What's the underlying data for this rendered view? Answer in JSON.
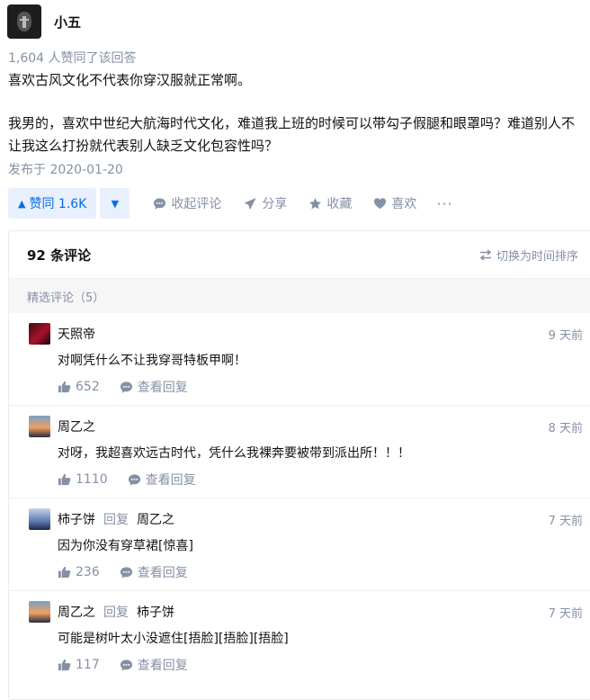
{
  "author": {
    "name": "小五"
  },
  "vote_count_text": "1,604 人赞同了该回答",
  "answer": {
    "paragraphs": [
      "喜欢古风文化不代表你穿汉服就正常啊。",
      "我男的，喜欢中世纪大航海时代文化，难道我上班的时候可以带勾子假腿和眼罩吗？难道别人不让我这么打扮就代表别人缺乏文化包容性吗？"
    ],
    "date": "发布于 2020-01-20"
  },
  "actions": {
    "vote_up": "赞同 1.6K",
    "collapse_comments": "收起评论",
    "share": "分享",
    "favorite": "收藏",
    "like": "喜欢",
    "more": "···"
  },
  "comments": {
    "count_label": "92 条评论",
    "switch_label": "切换为时间排序",
    "featured_label": "精选评论（5）",
    "items": [
      {
        "user": "天照帝",
        "reply_word": "",
        "target": "",
        "time": "9 天前",
        "text": "对啊凭什么不让我穿哥特板甲啊！",
        "likes": "652",
        "view_replies": "查看回复"
      },
      {
        "user": "周乙之",
        "reply_word": "",
        "target": "",
        "time": "8 天前",
        "text": "对呀，我超喜欢远古时代，凭什么我裸奔要被带到派出所！！！",
        "likes": "1110",
        "view_replies": "查看回复"
      },
      {
        "user": "柿子饼",
        "reply_word": "回复",
        "target": "周乙之",
        "time": "7 天前",
        "text": "因为你没有穿草裙[惊喜]",
        "likes": "236",
        "view_replies": "查看回复"
      },
      {
        "user": "周乙之",
        "reply_word": "回复",
        "target": "柿子饼",
        "time": "7 天前",
        "text": "可能是树叶太小没遮住[捂脸][捂脸][捂脸]",
        "likes": "117",
        "view_replies": "查看回复"
      }
    ]
  },
  "colors": {
    "accent": "#056de8",
    "muted": "#8590a6",
    "text": "#121212"
  }
}
